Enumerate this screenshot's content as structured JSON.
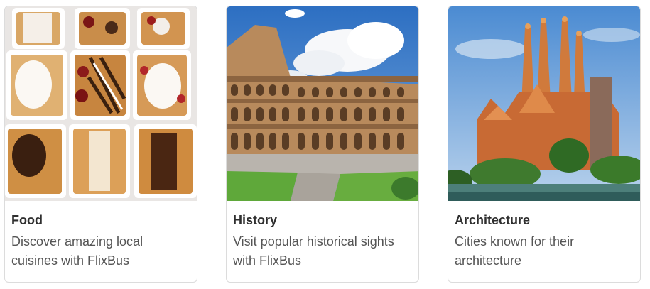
{
  "cards": [
    {
      "image": "belgian-waffles-with-toppings",
      "title": "Food",
      "description": "Discover amazing local cuisines with FlixBus"
    },
    {
      "image": "colosseum-rome",
      "title": "History",
      "description": "Visit popular historical sights with FlixBus"
    },
    {
      "image": "sagrada-familia-barcelona",
      "title": "Architecture",
      "description": "Cities known for their architecture"
    }
  ],
  "colors": {
    "card_border": "#dcdcdc",
    "title_text": "#2f2f2f",
    "description_text": "#555555",
    "sky_blue": "#3a78c8"
  }
}
